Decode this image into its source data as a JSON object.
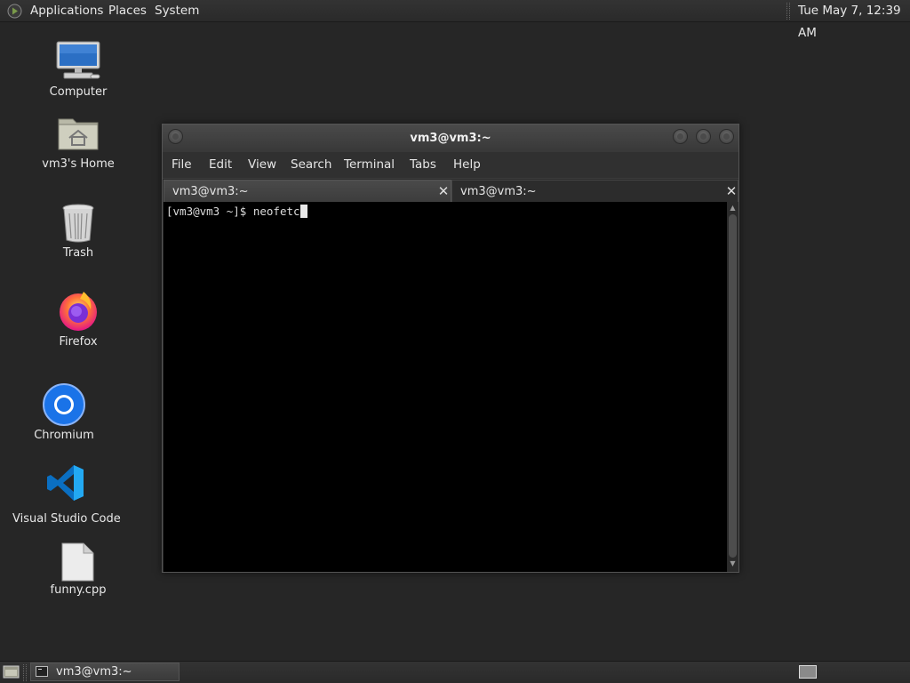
{
  "top_panel": {
    "menus": [
      "Applications",
      "Places",
      "System"
    ],
    "clock": "Tue May  7, 12:39 AM"
  },
  "desktop_icons": [
    {
      "label": "Computer",
      "icon": "computer-icon"
    },
    {
      "label": "vm3's Home",
      "icon": "home-folder-icon"
    },
    {
      "label": "Trash",
      "icon": "trash-icon"
    },
    {
      "label": "Firefox",
      "icon": "firefox-icon"
    },
    {
      "label": "Chromium",
      "icon": "chromium-icon"
    },
    {
      "label": "Visual Studio Code",
      "icon": "vscode-icon"
    },
    {
      "label": "funny.cpp",
      "icon": "file-icon"
    }
  ],
  "terminal": {
    "title": "vm3@vm3:~",
    "menu": [
      "File",
      "Edit",
      "View",
      "Search",
      "Terminal",
      "Tabs",
      "Help"
    ],
    "tabs": [
      {
        "label": "vm3@vm3:~",
        "active": true
      },
      {
        "label": "vm3@vm3:~",
        "active": false
      }
    ],
    "prompt": "[vm3@vm3 ~]$ ",
    "command": "neofetc"
  },
  "bottom_panel": {
    "task_label": "vm3@vm3:~"
  },
  "colors": {
    "desktop_bg": "#262626",
    "panel_bg": "#2f2f2f",
    "terminal_bg": "#000000",
    "firefox_orange": "#ff7139",
    "chromium_blue": "#1a73e8",
    "vscode_blue": "#23a9f2"
  }
}
